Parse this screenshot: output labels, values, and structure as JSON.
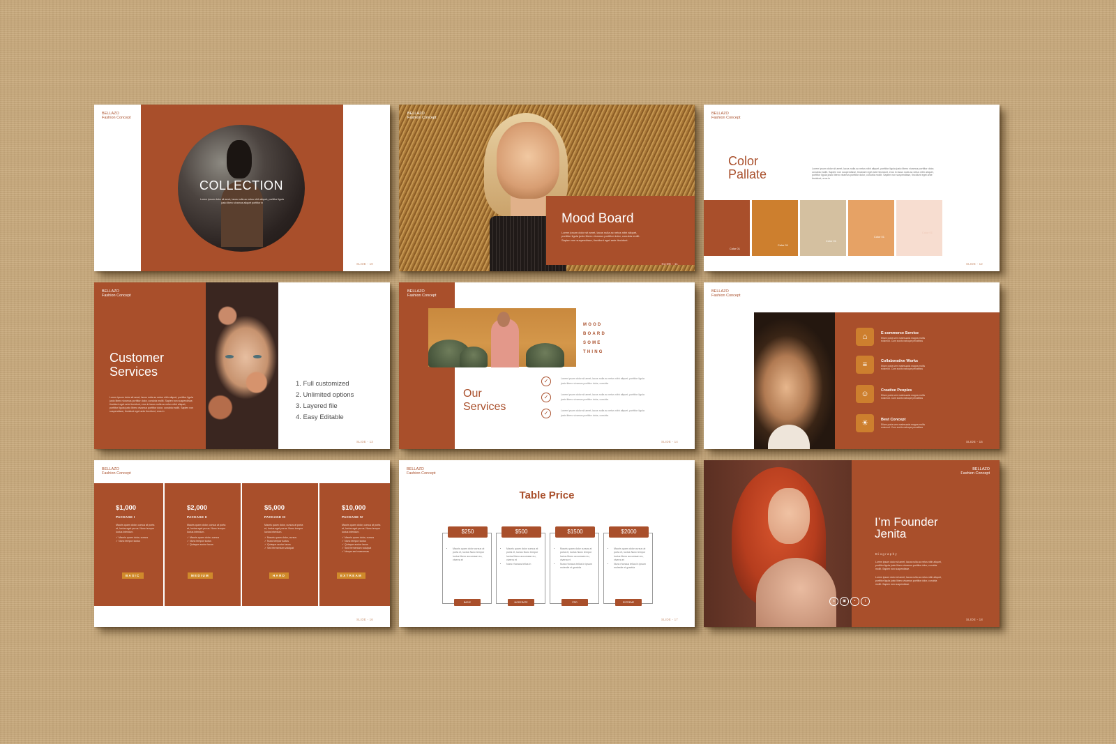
{
  "brand": {
    "line1": "BELLAZO",
    "line2": "Fashion Concept"
  },
  "colors": {
    "rust": "#a94f2b",
    "mustard": "#cd7f2e",
    "sand": "#d4c0a0",
    "peach": "#e6a265",
    "blush": "#f7ddd0",
    "background": "#c8a97c"
  },
  "slides": [
    {
      "id": "collection",
      "number": "SLIDE - 10",
      "title": "COLLECTION",
      "body": "Lorem ipsum dolor sit amet, lacus nulla ac netus nibh aliquet, porttitor ligula justo libero vivamus aliquet porttitor in"
    },
    {
      "id": "mood-board",
      "number": "SLIDE - 11",
      "title": "Mood Board",
      "body": "Lorem ipsum dolor sit amet, lacus nulla ac netus nibh aliquet, porttitor ligula justo libero vivamus porttitor dolor, conubia mollit. Sapien non suspendisse, tincidunt eget ante tincidunt."
    },
    {
      "id": "color-pallate",
      "number": "SLIDE - 12",
      "title_line1": "Color",
      "title_line2": "Pallate",
      "body": "Lorem ipsum dolor sit amet, lacus nulla ac netus nibh aliquet, porttitor ligula justo libero vivamus porttitor dolor, conubia mollit. Sapien non suspendisse, tincidunt eget ante tincidunt, eros in lacus nulla ac netus nibh aliquet, porttitor ligula justo libero vivamus porttitor dolor, conubia mollit. Sapien non suspendisse, tincidunt eget ante tincidunt, eros in",
      "swatches": [
        {
          "label": "Color 01",
          "color": "#a94f2b"
        },
        {
          "label": "Color 01",
          "color": "#cd7f2e"
        },
        {
          "label": "Color 01",
          "color": "#d4c0a0"
        },
        {
          "label": "Color 01",
          "color": "#e6a265"
        },
        {
          "label": "Color 01",
          "color": "#f7ddd0"
        }
      ]
    },
    {
      "id": "customer-services",
      "number": "SLIDE - 13",
      "title_line1": "Customer",
      "title_line2": "Services",
      "body": "Lorem ipsum dolor sit amet, lacus nulla ac netus nibh aliquet, porttitor ligula justo libero vivamus porttitor dolor, conubia mollit. Sapien non suspendisse, tincidunt eget ante tincidunt, eros in lacus nulla ac netus nibh aliquet, porttitor ligula justo libero vivamus porttitor dolor, conubia mollit. Sapien non suspendisse, tincidunt eget ante tincidunt, eros in",
      "list": [
        "1. Full customized",
        "2. Unlimited options",
        "3. Layered file",
        "4. Easy Editable"
      ]
    },
    {
      "id": "our-services",
      "number": "SLIDE - 14",
      "mood_words": [
        "MOOD",
        "BOARD",
        "SOME",
        "THING"
      ],
      "title_line1": "Our",
      "title_line2": "Services",
      "items": [
        "Lorem ipsum dolor sit amet, lacus nulla ac netus nibh aliquet, porttitor ligula justo libero vivamus porttitor dolor, conubia",
        "Lorem ipsum dolor sit amet, lacus nulla ac netus nibh aliquet, porttitor ligula justo libero vivamus porttitor dolor, conubia",
        "Lorem ipsum dolor sit amet, lacus nulla ac netus nibh aliquet, porttitor ligula justo libero vivamus porttitor dolor, conubia"
      ]
    },
    {
      "id": "services-icons",
      "number": "SLIDE - 15",
      "services": [
        {
          "title": "E-commerce Service",
          "icon": "basket-icon",
          "glyph": "⌂",
          "body": "Etiam porta sem malesuada magna mollis euismod. Cum sociis natoque penatibus"
        },
        {
          "title": "Collaborative Works",
          "icon": "sliders-icon",
          "glyph": "≡",
          "body": "Etiam porta sem malesuada magna mollis euismod. Cum sociis natoque penatibus"
        },
        {
          "title": "Creative Peoples",
          "icon": "user-icon",
          "glyph": "☺",
          "body": "Etiam porta sem malesuada magna mollis euismod. Cum sociis natoque penatibus"
        },
        {
          "title": "Best Concept",
          "icon": "lightbulb-icon",
          "glyph": "☀",
          "body": "Etiam porta sem malesuada magna mollis euismod. Cum sociis natoque penatibus"
        }
      ]
    },
    {
      "id": "packages",
      "number": "SLIDE - 16",
      "packages": [
        {
          "price": "$1,000",
          "name": "PACKAGE I",
          "body": "Mauris quam dolor, cursus at porta et, luctus eget purus. Nunc tempor luctus interdum.",
          "features": [
            "Mauris quam dolor, cursus",
            "Nunc tempor luctus"
          ],
          "tag": "BASIC"
        },
        {
          "price": "$2,000",
          "name": "PACKAGE II",
          "body": "Mauris quam dolor, cursus at porta et, luctus eget purus. Nunc tempor luctus interdum.",
          "features": [
            "Mauris quam dolor, cursus",
            "Nunc tempor luctus",
            "Quisque auctor lacus"
          ],
          "tag": "MEDIUM"
        },
        {
          "price": "$5,000",
          "name": "PACKAGE III",
          "body": "Mauris quam dolor, cursus at porta et, luctus eget purus. Nunc tempor luctus interdum.",
          "features": [
            "Mauris quam dolor, cursus",
            "Nunc tempor luctus",
            "Quisque auctor lacus",
            "Sed fermentum volutpat"
          ],
          "tag": "HARD"
        },
        {
          "price": "$10,000",
          "name": "PACKAGE IV",
          "body": "Mauris quam dolor, cursus at porta et, luctus eget purus. Nunc tempor luctus interdum.",
          "features": [
            "Mauris quam dolor, cursus",
            "Nunc tempor luctus",
            "Quisque auctor lacus",
            "Sed fermentum volutpat",
            "Neque sed maecenas"
          ],
          "tag": "EXTREAM"
        }
      ]
    },
    {
      "id": "table-price",
      "number": "SLIDE - 17",
      "title": "Table Price",
      "plans": [
        {
          "price": "$250",
          "level": "BASIC",
          "features": [
            "Mauris quam dolor cursus at porta et, luctus Nunc tempor luctus libero accumsan eu, viverra et"
          ]
        },
        {
          "price": "$500",
          "level": "MODERATE",
          "features": [
            "Mauris quam dolor cursus at porta et, luctus Nunc tempor luctus libero accumsan eu, viverra et",
            "Nunc rhoncus tellus in"
          ]
        },
        {
          "price": "$1500",
          "level": "PRO",
          "features": [
            "Mauris quam dolor cursus at porta et, luctus Nunc tempor luctus libero accumsan eu, viverra et",
            "Nunc rhoncus tellus in ipsum molestie et gravida"
          ]
        },
        {
          "price": "$2000",
          "level": "EXTREME",
          "features": [
            "Mauris quam dolor cursus at porta et, luctus Nunc tempor luctus libero accumsan eu, viverra et",
            "Nunc rhoncus tellus in ipsum molestie et gravida"
          ]
        }
      ]
    },
    {
      "id": "founder",
      "number": "SLIDE - 18",
      "title_line1": "I’m Founder",
      "title_line2": "Jenita",
      "subtitle": "Biography",
      "para1": "Lorem ipsum dolor sit amet, lacus nulla ac netus nibh aliquet, porttitor ligula justo libero vivamus porttitor dolor, conubia mollit. Sapien non suspendisse.",
      "para2": "Lorem ipsum dolor sit amet, lacus nulla ac netus nibh aliquet, porttitor ligula justo libero vivamus porttitor dolor, conubia mollit. Sapien non suspendisse.",
      "social": [
        {
          "icon": "skype-icon",
          "glyph": "s"
        },
        {
          "icon": "instagram-icon",
          "glyph": "▣"
        },
        {
          "icon": "twitter-icon",
          "glyph": "•"
        },
        {
          "icon": "tumblr-icon",
          "glyph": "t"
        }
      ]
    }
  ]
}
